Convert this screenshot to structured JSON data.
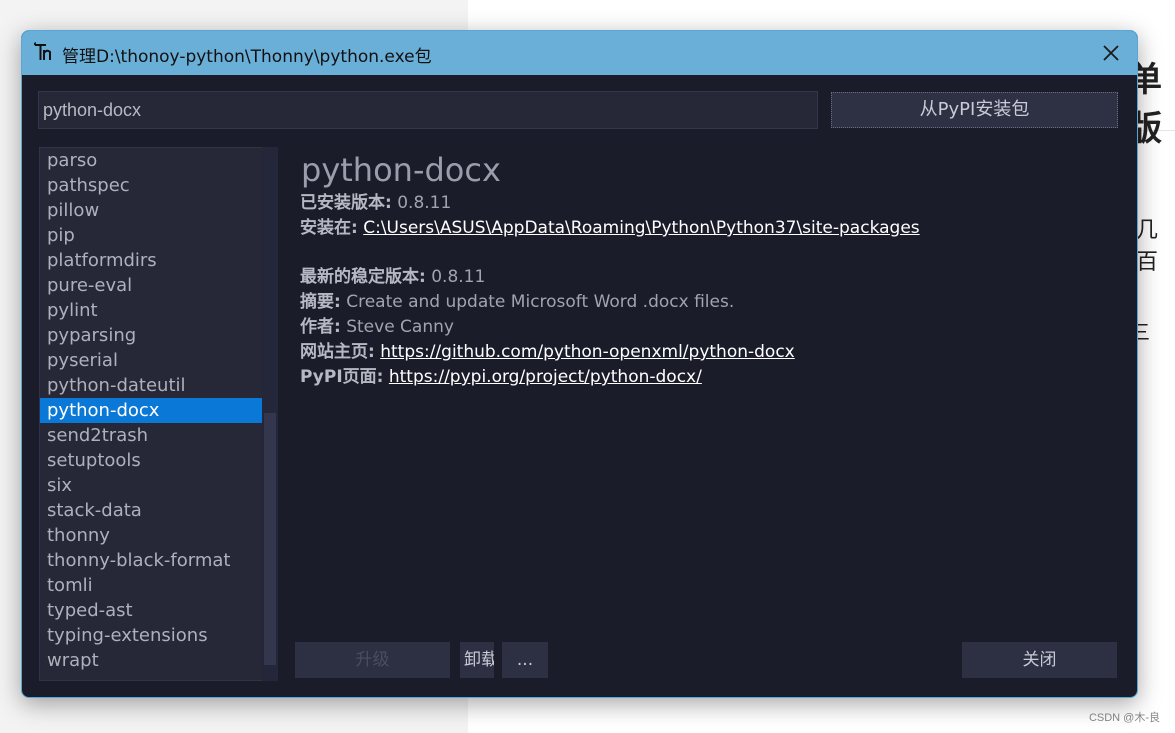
{
  "window": {
    "title": "管理D:\\thonoy-python\\Thonny\\python.exe包"
  },
  "search": {
    "value": "python-docx",
    "install_button": "从PyPI安装包"
  },
  "packages": [
    "parso",
    "pathspec",
    "pillow",
    "pip",
    "platformdirs",
    "pure-eval",
    "pylint",
    "pyparsing",
    "pyserial",
    "python-dateutil",
    "python-docx",
    "send2trash",
    "setuptools",
    "six",
    "stack-data",
    "thonny",
    "thonny-black-format",
    "tomli",
    "typed-ast",
    "typing-extensions",
    "wrapt"
  ],
  "selected_package": "python-docx",
  "details": {
    "name": "python-docx",
    "installed_version_label": "已安装版本:",
    "installed_version": "0.8.11",
    "location_label": "安装在:",
    "location": "C:\\Users\\ASUS\\AppData\\Roaming\\Python\\Python37\\site-packages",
    "latest_version_label": "最新的稳定版本:",
    "latest_version": "0.8.11",
    "summary_label": "摘要:",
    "summary": "Create and update Microsoft Word .docx files.",
    "author_label": "作者:",
    "author": "Steve Canny",
    "homepage_label": "网站主页:",
    "homepage": "https://github.com/python-openxml/python-docx",
    "pypi_label": "PyPI页面:",
    "pypi_url": "https://pypi.org/project/python-docx/"
  },
  "buttons": {
    "upgrade": "升级",
    "uninstall": "卸载",
    "more": "...",
    "close": "关闭"
  },
  "background": {
    "text1": "单版",
    "text2": "几百",
    "text3": "三"
  },
  "watermark": "CSDN @木-良",
  "colors": {
    "titlebar": "#6aafd8",
    "window_bg": "#1b1c29",
    "selection": "#0a78d7"
  }
}
